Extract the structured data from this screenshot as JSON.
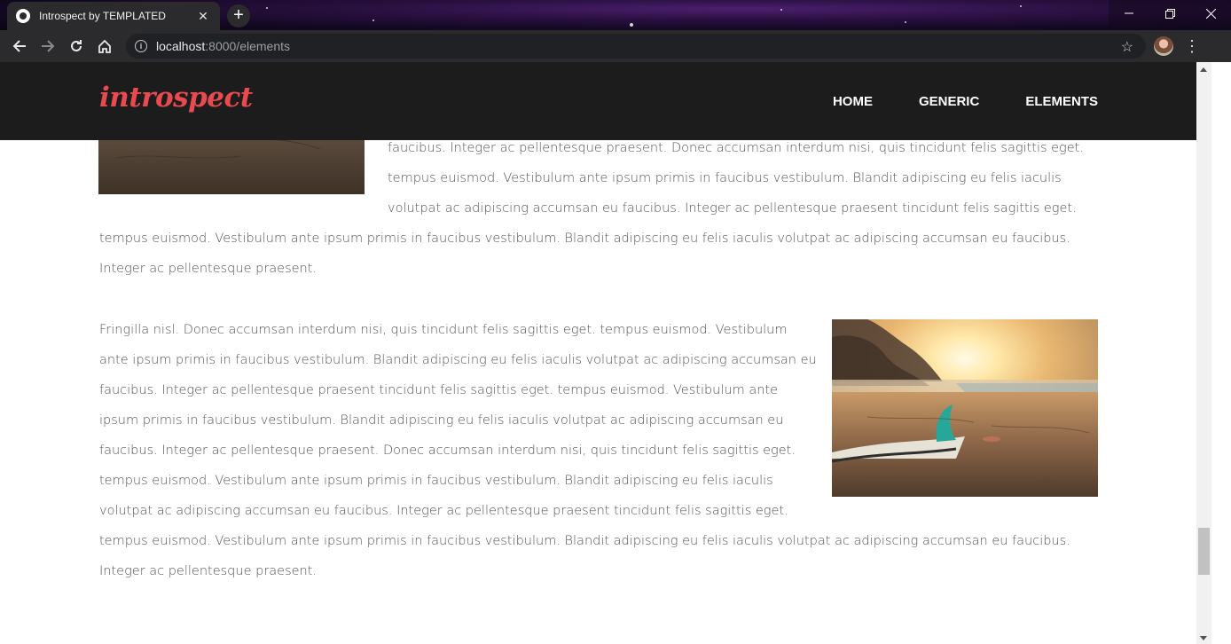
{
  "browser": {
    "tab_title": "Introspect by TEMPLATED",
    "url_host": "localhost",
    "url_rest": ":8000/elements",
    "icons": {
      "favicon": "globe-icon",
      "close": "close-icon",
      "new_tab": "plus-icon",
      "back": "back-arrow-icon",
      "forward": "forward-arrow-icon",
      "reload": "reload-icon",
      "home": "home-icon",
      "info": "info-icon",
      "bookmark": "star-icon",
      "menu": "kebab-menu-icon",
      "minimize": "minimize-icon",
      "restore": "restore-icon",
      "window_close": "window-close-icon"
    }
  },
  "site": {
    "logo": "introspect",
    "nav": [
      "HOME",
      "GENERIC",
      "ELEMENTS"
    ],
    "colors": {
      "logo": "#e84a4f",
      "header_bg": "#1c1c1c",
      "text": "#555555"
    }
  },
  "content": {
    "para1_lines": [
      "faucibus. Integer ac pellentesque praesent. Donec accumsan interdum nisi, quis tincidunt felis sagittis eget.",
      "tempus euismod. Vestibulum ante ipsum primis in faucibus vestibulum. Blandit adipiscing eu felis iaculis",
      "volutpat ac adipiscing accumsan eu faucibus. Integer ac pellentesque praesent tincidunt felis sagittis eget.",
      "tempus euismod. Vestibulum ante ipsum primis in faucibus vestibulum. Blandit adipiscing eu felis iaculis volutpat ac adipiscing accumsan eu faucibus.",
      "Integer ac pellentesque praesent."
    ],
    "para2_lines": [
      "Fringilla nisl. Donec accumsan interdum nisi, quis tincidunt felis sagittis eget. tempus euismod. Vestibulum",
      "ante ipsum primis in faucibus vestibulum. Blandit adipiscing eu felis iaculis volutpat ac adipiscing accumsan eu",
      "faucibus. Integer ac pellentesque praesent tincidunt felis sagittis eget. tempus euismod. Vestibulum ante",
      "ipsum primis in faucibus vestibulum. Blandit adipiscing eu felis iaculis volutpat ac adipiscing accumsan eu",
      "faucibus. Integer ac pellentesque praesent. Donec accumsan interdum nisi, quis tincidunt felis sagittis eget.",
      "tempus euismod. Vestibulum ante ipsum primis in faucibus vestibulum. Blandit adipiscing eu felis iaculis",
      "volutpat ac adipiscing accumsan eu faucibus. Integer ac pellentesque praesent tincidunt felis sagittis eget.",
      "tempus euismod. Vestibulum ante ipsum primis in faucibus vestibulum. Blandit adipiscing eu felis iaculis volutpat ac adipiscing accumsan eu faucibus.",
      "Integer ac pellentesque praesent."
    ]
  }
}
